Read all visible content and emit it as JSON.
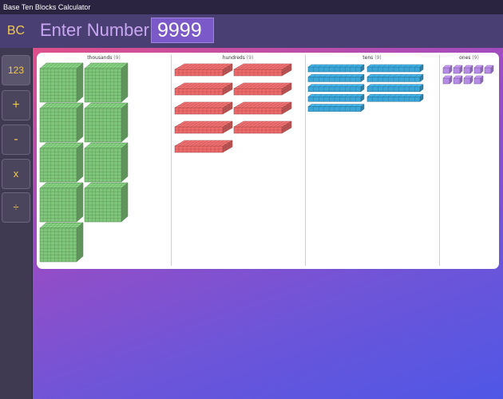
{
  "window": {
    "title": "Base Ten Blocks Calculator"
  },
  "header": {
    "logo": "BC",
    "enter_label": "Enter Number",
    "number_value": "9999"
  },
  "sidebar": {
    "buttons": [
      {
        "label": "123"
      },
      {
        "label": "+"
      },
      {
        "label": "-"
      },
      {
        "label": "x"
      },
      {
        "label": "÷"
      }
    ]
  },
  "columns": [
    {
      "name": "thousands",
      "count": "(9)",
      "blocks": 9,
      "color": "#7fc77a"
    },
    {
      "name": "hundreds",
      "count": "(9)",
      "blocks": 9,
      "color": "#ef6a6a"
    },
    {
      "name": "tens",
      "count": "(9)",
      "blocks": 9,
      "color": "#3aa6d8"
    },
    {
      "name": "ones",
      "count": "(9)",
      "blocks": 9,
      "color": "#b68ce6"
    }
  ]
}
